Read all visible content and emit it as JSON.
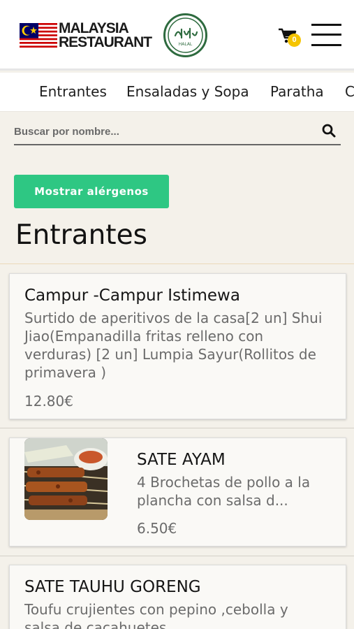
{
  "header": {
    "brand_line1": "MALAYSIA",
    "brand_line2": "RESTAURANT",
    "halal_label": "HALAL",
    "cart_count": "0"
  },
  "tabs": [
    "Entrantes",
    "Ensaladas y Sopa",
    "Paratha",
    "C"
  ],
  "search": {
    "placeholder": "Buscar por nombre..."
  },
  "allergens_button": "Mostrar alérgenos",
  "section": {
    "title": "Entrantes"
  },
  "items": [
    {
      "title": "Campur -Campur Istimewa",
      "desc": [
        "Surtido de aperitivos de la casa[2 un] Shui",
        "Jiao(Empanadilla fritas relleno con",
        "verduras) [2 un] Lumpia Sayur(Rollitos de",
        "primavera )"
      ],
      "price": "12.80€"
    },
    {
      "title": "SATE AYAM",
      "desc": [
        "4 Brochetas de pollo a la",
        "plancha con salsa d..."
      ],
      "price": "6.50€"
    },
    {
      "title": "SATE TAUHU GORENG",
      "desc": [
        "Toufu crujientes con pepino ,cebolla y",
        "salsa de cacahuetes"
      ]
    }
  ],
  "colors": {
    "accent_green": "#2ec783",
    "cart_badge": "#f5c400",
    "halal_green": "#2e6b3f"
  }
}
